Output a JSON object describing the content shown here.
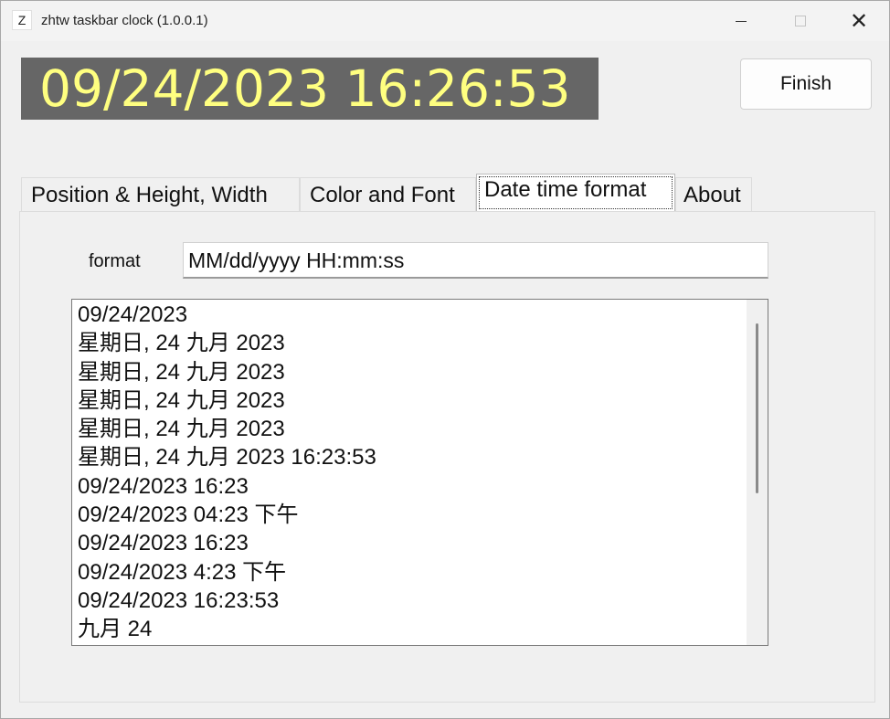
{
  "window": {
    "icon_letter": "Z",
    "title": "zhtw taskbar clock (1.0.0.1)",
    "close_glyph": "✕"
  },
  "clock": {
    "display": "09/24/2023 16:26:53",
    "bg_color": "#666666",
    "fg_color": "#ffff80"
  },
  "finish_label": "Finish",
  "tabs": [
    {
      "label": "Position & Height, Width"
    },
    {
      "label": "Color and Font"
    },
    {
      "label": "Date time format",
      "active": true
    },
    {
      "label": "About"
    }
  ],
  "format": {
    "label": "format",
    "value": "MM/dd/yyyy HH:mm:ss"
  },
  "list": {
    "items": [
      "09/24/2023",
      "星期日, 24 九月 2023",
      "星期日, 24 九月 2023",
      "星期日, 24 九月 2023",
      "星期日, 24 九月 2023",
      "星期日, 24 九月 2023 16:23:53",
      "09/24/2023 16:23",
      "09/24/2023 04:23 下午",
      "09/24/2023 16:23",
      "09/24/2023 4:23 下午",
      "09/24/2023 16:23:53",
      "九月 24"
    ]
  }
}
